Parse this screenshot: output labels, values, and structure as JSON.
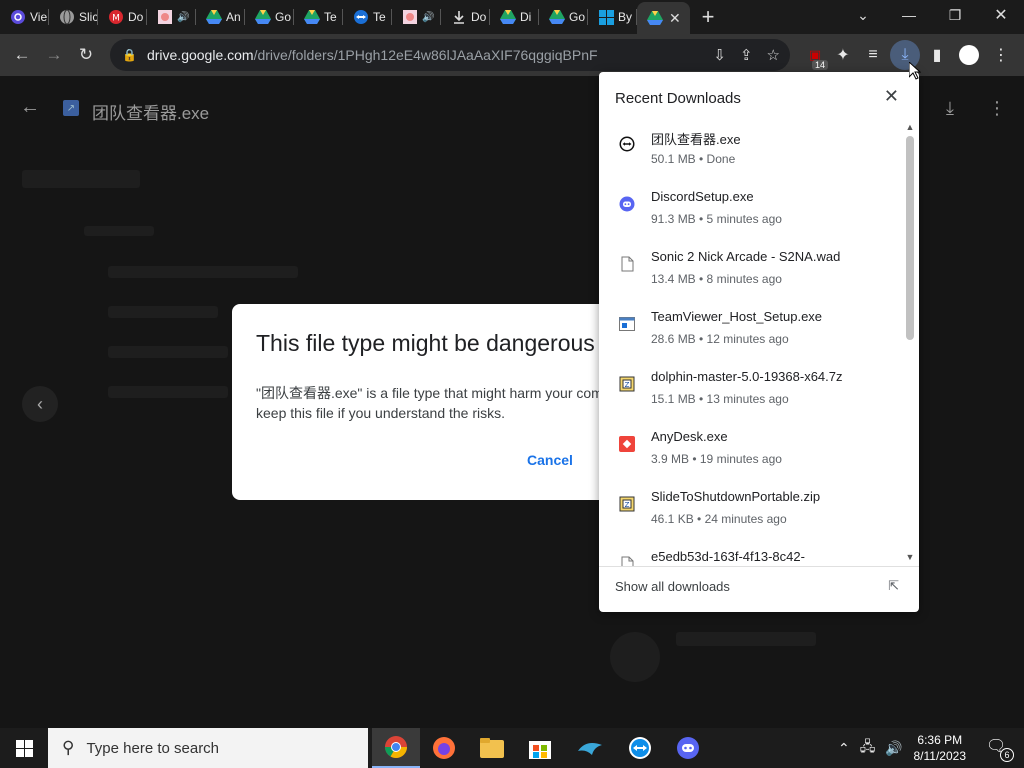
{
  "tabs": [
    {
      "label": "Vie",
      "icon": "threads-icon",
      "icon_color": "#5b4bdb"
    },
    {
      "label": "Slic",
      "icon": "globe-icon",
      "icon_color": "#9a9a9a"
    },
    {
      "label": "Do",
      "icon": "mega-icon",
      "icon_color": "#d9272e"
    },
    {
      "label": "",
      "icon": "anime-favicon-icon",
      "icon_color": "#e88"
    },
    {
      "label": "An",
      "icon": "google-drive-icon",
      "icon_color": "#34a853"
    },
    {
      "label": "Go",
      "icon": "google-drive-icon",
      "icon_color": "#34a853"
    },
    {
      "label": "Te",
      "icon": "google-drive-icon",
      "icon_color": "#34a853"
    },
    {
      "label": "Te",
      "icon": "teamviewer-icon",
      "icon_color": "#1a6fd6"
    },
    {
      "label": "",
      "icon": "anime-favicon-icon",
      "icon_color": "#e88"
    },
    {
      "label": "Do",
      "icon": "download-icon",
      "icon_color": "#ddd"
    },
    {
      "label": "Di",
      "icon": "google-drive-icon",
      "icon_color": "#34a853"
    },
    {
      "label": "Go",
      "icon": "google-drive-icon",
      "icon_color": "#34a853"
    },
    {
      "label": "By",
      "icon": "windows-icon",
      "icon_color": "#1a9fe0"
    }
  ],
  "active_tab_icon": "google-drive-icon",
  "address": {
    "host": "drive.google.com",
    "path": "/drive/folders/1PHgh12eE4w86lJAaAaXIF76qggiqBPnF"
  },
  "extension_badge": "14",
  "preview": {
    "file_name": "团队查看器.exe"
  },
  "dialog": {
    "title": "This file type might be dangerous",
    "body": "\"团队查看器.exe\" is a file type that might harm your computer. Only keep this file if you understand the risks.",
    "cancel_label": "Cancel"
  },
  "downloads": {
    "title": "Recent Downloads",
    "footer": "Show all downloads",
    "items": [
      {
        "name": "团队查看器.exe",
        "meta": "50.1 MB • Done",
        "icon": "teamviewer-icon"
      },
      {
        "name": "DiscordSetup.exe",
        "meta": "91.3 MB • 5 minutes ago",
        "icon": "discord-icon"
      },
      {
        "name": "Sonic 2 Nick Arcade - S2NA.wad",
        "meta": "13.4 MB • 8 minutes ago",
        "icon": "file-icon"
      },
      {
        "name": "TeamViewer_Host_Setup.exe",
        "meta": "28.6 MB • 12 minutes ago",
        "icon": "installer-icon"
      },
      {
        "name": "dolphin-master-5.0-19368-x64.7z",
        "meta": "15.1 MB • 13 minutes ago",
        "icon": "archive-icon"
      },
      {
        "name": "AnyDesk.exe",
        "meta": "3.9 MB • 19 minutes ago",
        "icon": "anydesk-icon"
      },
      {
        "name": "SlideToShutdownPortable.zip",
        "meta": "46.1 KB • 24 minutes ago",
        "icon": "archive-icon"
      },
      {
        "name": "e5edb53d-163f-4f13-8c42-",
        "meta": "",
        "icon": "file-icon"
      }
    ]
  },
  "taskbar": {
    "search_placeholder": "Type here to search",
    "time": "6:36 PM",
    "date": "8/11/2023",
    "notifications": "6"
  }
}
